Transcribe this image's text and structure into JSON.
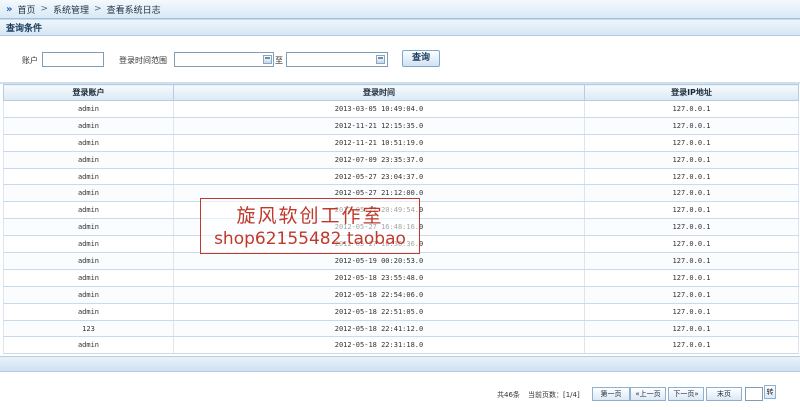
{
  "breadcrumb": {
    "items": [
      "首页",
      "系统管理",
      "查看系统日志"
    ]
  },
  "query": {
    "section_title": "查询条件",
    "account_label": "账户",
    "account_value": "",
    "time_range_label": "登录时间范围",
    "to_label": "至",
    "start_value": "",
    "end_value": "",
    "search_button": "查询"
  },
  "table": {
    "headers": [
      "登录账户",
      "登录时间",
      "登录IP地址"
    ],
    "rows": [
      [
        "admin",
        "2013-03-05 10:49:04.0",
        "127.0.0.1"
      ],
      [
        "admin",
        "2012-11-21 12:15:35.0",
        "127.0.0.1"
      ],
      [
        "admin",
        "2012-11-21 10:51:19.0",
        "127.0.0.1"
      ],
      [
        "admin",
        "2012-07-09 23:35:37.0",
        "127.0.0.1"
      ],
      [
        "admin",
        "2012-05-27 23:04:37.0",
        "127.0.0.1"
      ],
      [
        "admin",
        "2012-05-27 21:12:00.0",
        "127.0.0.1"
      ],
      [
        "admin",
        "2012-05-27 20:49:54.0",
        "127.0.0.1"
      ],
      [
        "admin",
        "2012-05-27 16:48:16.0",
        "127.0.0.1"
      ],
      [
        "admin",
        "2012-05-27 16:36:36.0",
        "127.0.0.1"
      ],
      [
        "admin",
        "2012-05-19 00:20:53.0",
        "127.0.0.1"
      ],
      [
        "admin",
        "2012-05-18 23:55:48.0",
        "127.0.0.1"
      ],
      [
        "admin",
        "2012-05-18 22:54:06.0",
        "127.0.0.1"
      ],
      [
        "admin",
        "2012-05-18 22:51:05.0",
        "127.0.0.1"
      ],
      [
        "123",
        "2012-05-18 22:41:12.0",
        "127.0.0.1"
      ],
      [
        "admin",
        "2012-05-18 22:31:18.0",
        "127.0.0.1"
      ]
    ]
  },
  "pager": {
    "total": "共46条",
    "current": "当前页数：[1/4]",
    "first": "第一页",
    "prev": "«上一页",
    "next": "下一页»",
    "last": "末页",
    "goto_value": "",
    "go": "转"
  },
  "watermark": {
    "line1": "旋风软创工作室",
    "line2": "shop62155482.taobao"
  },
  "colors": {
    "accent": "#1e63b8",
    "header_bg": "#dbe8f4",
    "watermark": "#c0392b"
  }
}
